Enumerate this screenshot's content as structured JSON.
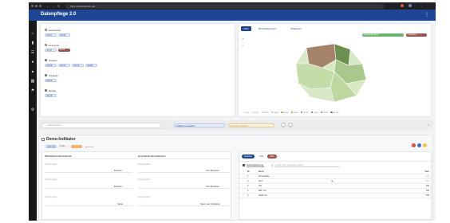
{
  "browser": {
    "url": "https://www.test.tde.de/..."
  },
  "app": {
    "title": "Datenpflege 2.0",
    "menu_icon": "more-vertical-icon"
  },
  "rail_icons": [
    "home-icon",
    "chart-icon",
    "layers-icon",
    "people-icon",
    "map-icon",
    "table-icon",
    "flag-icon",
    "settings-icon"
  ],
  "filters": {
    "groups": [
      {
        "label": "Gebietsteile",
        "chips": [
          "SN 67",
          "SN 96"
        ]
      },
      {
        "label": "Gemeinde",
        "chips": [
          "SN 67",
          "SN 96"
        ]
      },
      {
        "label": "Ortsteile",
        "chips": [
          "SN 45",
          "SN 51",
          "SN 72",
          "SN 89"
        ]
      },
      {
        "label": "Stadtteile",
        "chips": [
          "SN 55"
        ]
      },
      {
        "label": "Bezirke",
        "chips": [
          "SN 55"
        ]
      }
    ]
  },
  "map": {
    "tabs": [
      "Karte",
      "Merkmalsgruppen",
      "Indikatoren"
    ],
    "overlay_chips": [
      "Merkmalsgruppen",
      "Indikatoren"
    ],
    "legend": [
      "0-10",
      "10-20",
      "20-30",
      "30-40",
      "40-50",
      "50-60",
      "60-70",
      "70-80",
      "80-90",
      "90-100"
    ],
    "colors": {
      "dark": "#6a8f4e",
      "mid": "#a8c98b",
      "light": "#d7e8c4",
      "brown": "#a3846a"
    }
  },
  "search": {
    "placeholder": "Indikator finden...",
    "chip_selected": "Indikatoren auswählen",
    "chip_orange": "Merkmale auswählen"
  },
  "indicator": {
    "title": "Demo-Indikator",
    "meta": [
      "2015_06",
      "Quelle"
    ],
    "left_title": "Öffentliche Informationen",
    "right_title": "Geschützte Informationen",
    "left_rows": [
      {
        "label": "Detail-Angaben",
        "value": "Beispiel"
      },
      {
        "label": "Detail-Angaben",
        "value": "Beispiel"
      },
      {
        "label": "Detail-Angaben",
        "value": "Stelle"
      }
    ],
    "right_rows": [
      {
        "label": "Detail-Angaben",
        "value": "Ihre Beispiele"
      },
      {
        "label": "Detail-Angaben",
        "value": "Ihre Beispiele"
      },
      {
        "label": "Detail-Angaben",
        "value": "Name der Institution"
      }
    ]
  },
  "table": {
    "tabs": [
      "Gebiete",
      "Jahr",
      "Wert"
    ],
    "filter_label": "Gebietsgliederung",
    "search_placeholder": "Suche nach Gebietsteil, Name",
    "headers": [
      "Nr",
      "Name",
      "Wert"
    ],
    "rows": [
      {
        "nr": "1",
        "name": "Ahrensfelde",
        "value": "300"
      },
      {
        "nr": "2",
        "name": "Dorf",
        "value": "300"
      },
      {
        "nr": "3",
        "name": "Ost",
        "value": "300"
      },
      {
        "nr": "4",
        "name": "Mitt- Ost",
        "value": "300"
      },
      {
        "nr": "5",
        "name": "Stadt Ost",
        "value": "300"
      }
    ]
  }
}
